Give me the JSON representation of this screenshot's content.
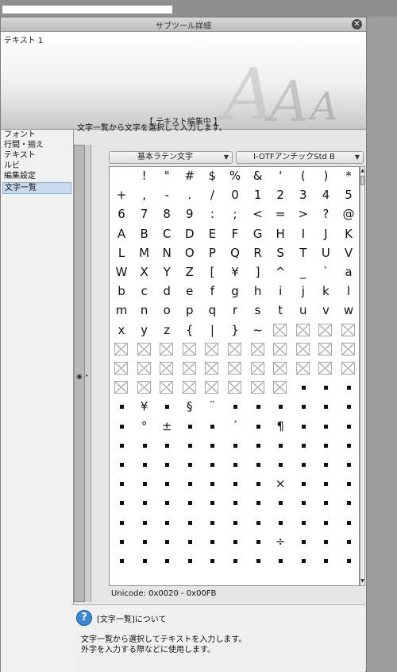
{
  "window": {
    "title": "サブツール詳細"
  },
  "preview": {
    "text_name": "テキスト 1",
    "status": "【 テキスト編集中 】"
  },
  "sidebar": {
    "items": [
      {
        "label": "フォント"
      },
      {
        "label": "行間・揃え"
      },
      {
        "label": "テキスト"
      },
      {
        "label": "ルビ"
      },
      {
        "label": "編集設定"
      },
      {
        "label": "文字一覧"
      }
    ],
    "active_index": 5
  },
  "main": {
    "description": "文字一覧から文字を選択して入力します。",
    "charset_dropdown": "基本ラテン文字",
    "font_dropdown": "I-OTFアンチックStd B",
    "unicode_range": "Unicode: 0x0020 - 0x00FB"
  },
  "char_grid": {
    "rows": [
      [
        " ",
        "!",
        "\"",
        "#",
        "$",
        "%",
        "&",
        "'",
        "(",
        ")",
        "*"
      ],
      [
        "+",
        ",",
        "-",
        ".",
        "/",
        "0",
        "1",
        "2",
        "3",
        "4",
        "5"
      ],
      [
        "6",
        "7",
        "8",
        "9",
        ":",
        ";",
        "<",
        "=",
        ">",
        "?",
        "@"
      ],
      [
        "A",
        "B",
        "C",
        "D",
        "E",
        "F",
        "G",
        "H",
        "I",
        "J",
        "K"
      ],
      [
        "L",
        "M",
        "N",
        "O",
        "P",
        "Q",
        "R",
        "S",
        "T",
        "U",
        "V"
      ],
      [
        "W",
        "X",
        "Y",
        "Z",
        "[",
        "¥",
        "]",
        "^",
        "_",
        "`",
        "a"
      ],
      [
        "b",
        "c",
        "d",
        "e",
        "f",
        "g",
        "h",
        "i",
        "j",
        "k",
        "l"
      ],
      [
        "m",
        "n",
        "o",
        "p",
        "q",
        "r",
        "s",
        "t",
        "u",
        "v",
        "w"
      ],
      [
        "x",
        "y",
        "z",
        "{",
        "|",
        "}",
        "~",
        "☒",
        "☒",
        "☒",
        "☒"
      ],
      [
        "☒",
        "☒",
        "☒",
        "☒",
        "☒",
        "☒",
        "☒",
        "☒",
        "☒",
        "☒",
        "☒"
      ],
      [
        "☒",
        "☒",
        "☒",
        "☒",
        "☒",
        "☒",
        "☒",
        "☒",
        "☒",
        "☒",
        "☒"
      ],
      [
        "☒",
        "☒",
        "☒",
        "☒",
        "☒",
        "☒",
        "☒",
        "☒",
        "■",
        "■",
        "■"
      ],
      [
        "■",
        "¥",
        "■",
        "§",
        "¨",
        "■",
        "■",
        "■",
        "■",
        "■",
        "■"
      ],
      [
        "■",
        "°",
        "±",
        "■",
        "■",
        "´",
        "■",
        "¶",
        "■",
        "■",
        "■"
      ],
      [
        "■",
        "■",
        "■",
        "■",
        "■",
        "■",
        "■",
        "■",
        "■",
        "■",
        "■"
      ],
      [
        "■",
        "■",
        "■",
        "■",
        "■",
        "■",
        "■",
        "■",
        "■",
        "■",
        "■"
      ],
      [
        "■",
        "■",
        "■",
        "■",
        "■",
        "■",
        "■",
        "×",
        "■",
        "■",
        "■"
      ],
      [
        "■",
        "■",
        "■",
        "■",
        "■",
        "■",
        "■",
        "■",
        "■",
        "■",
        "■"
      ],
      [
        "■",
        "■",
        "■",
        "■",
        "■",
        "■",
        "■",
        "■",
        "■",
        "■",
        "■"
      ],
      [
        "■",
        "■",
        "■",
        "■",
        "■",
        "■",
        "■",
        "÷",
        "■",
        "■",
        "■"
      ],
      [
        "■",
        "■",
        "■",
        "■",
        "■",
        "■",
        "■",
        "■",
        "■",
        "■",
        "■"
      ]
    ]
  },
  "help": {
    "title": "[文字一覧]について",
    "line1": "文字一覧から選択してテキストを入力します。",
    "line2": "外字を入力する際などに使用します。"
  },
  "colors": {
    "accent": "#3b87d0",
    "selection": "#c9daed"
  },
  "icons": {
    "close": "close-icon",
    "help": "help-icon",
    "eye": "eye-icon"
  }
}
